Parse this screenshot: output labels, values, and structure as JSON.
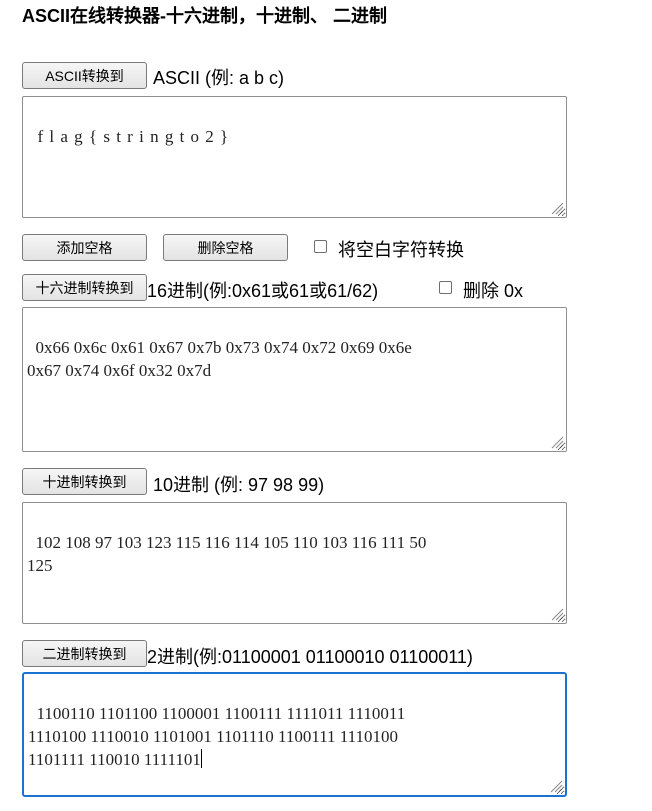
{
  "title": "ASCII在线转换器-十六进制，十进制、 二进制",
  "ascii": {
    "button": "ASCII转换到",
    "label": "ASCII (例: a b c)",
    "value": "f l a g { s t r i n g t o 2 }"
  },
  "spaces": {
    "add_button": "添加空格",
    "remove_button": "删除空格",
    "whitespace_checkbox_label": "将空白字符转换"
  },
  "hex": {
    "button": "十六进制转换到",
    "label": "16进制(例:0x61或61或61/62)",
    "remove0x_label": "删除 0x",
    "value": "0x66 0x6c 0x61 0x67 0x7b 0x73 0x74 0x72 0x69 0x6e\n0x67 0x74 0x6f 0x32 0x7d"
  },
  "dec": {
    "button": "十进制转换到",
    "label": "10进制 (例: 97 98 99)",
    "value": "102 108 97 103 123 115 116 114 105 110 103 116 111 50\n125"
  },
  "bin": {
    "button": "二进制转换到",
    "label": "2进制(例:01100001 01100010 01100011)",
    "value": "1100110 1101100 1100001 1100111 1111011 1110011\n1110100 1110010 1101001 1101110 1100111 1110100\n1101111 110010 1111101"
  }
}
